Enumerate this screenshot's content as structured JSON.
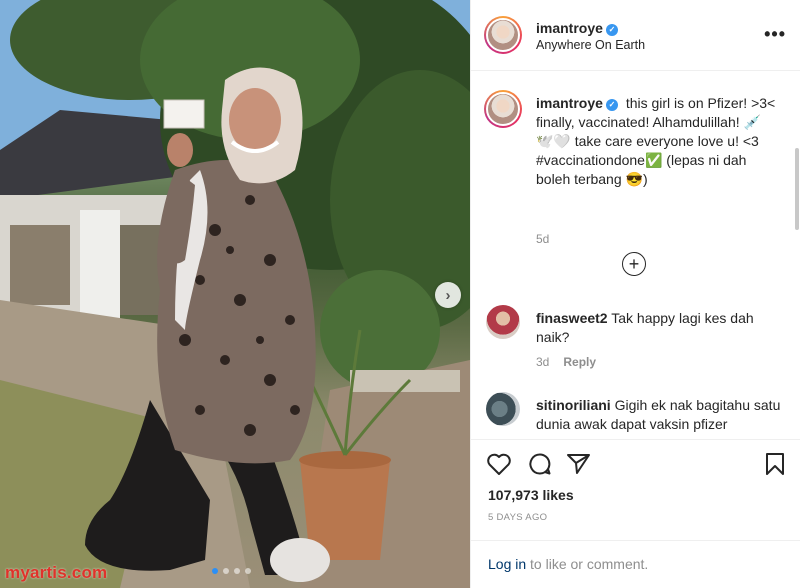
{
  "post": {
    "username": "imantroye",
    "location": "Anywhere On Earth",
    "more_label": "•••",
    "verified_glyph": "✓"
  },
  "caption": {
    "username": "imantroye",
    "text": "this girl is on Pfizer! >3< finally, vaccinated! Alhamdulillah! 💉🕊️🤍 take care everyone love u! <3 #vaccinationdone✅ (lepas ni dah boleh terbang 😎)",
    "time": "5d"
  },
  "load_more_glyph": "+",
  "comments": [
    {
      "username": "finasweet2",
      "text": "Tak happy lagi kes dah naik?",
      "time": "3d",
      "reply_label": "Reply"
    },
    {
      "username": "sitinoriliani",
      "text": "Gigih ek nak bagitahu satu dunia awak dapat vaksin pfizer",
      "time": "",
      "reply_label": ""
    }
  ],
  "actions": {
    "like_icon": "heart-icon",
    "comment_icon": "comment-icon",
    "share_icon": "paper-plane-icon",
    "save_icon": "bookmark-icon"
  },
  "likes": "107,973 likes",
  "time_ago": "5 DAYS AGO",
  "login": {
    "link_label": "Log in",
    "suffix": " to like or comment."
  },
  "carousel": {
    "next_glyph": "›",
    "slide_count": 4,
    "active_index": 0
  },
  "watermark": "myartis.com",
  "colors": {
    "link_blue": "#00376b",
    "verified_blue": "#3897f0",
    "muted": "#8e8e8e",
    "watermark_red": "#e0322b"
  }
}
